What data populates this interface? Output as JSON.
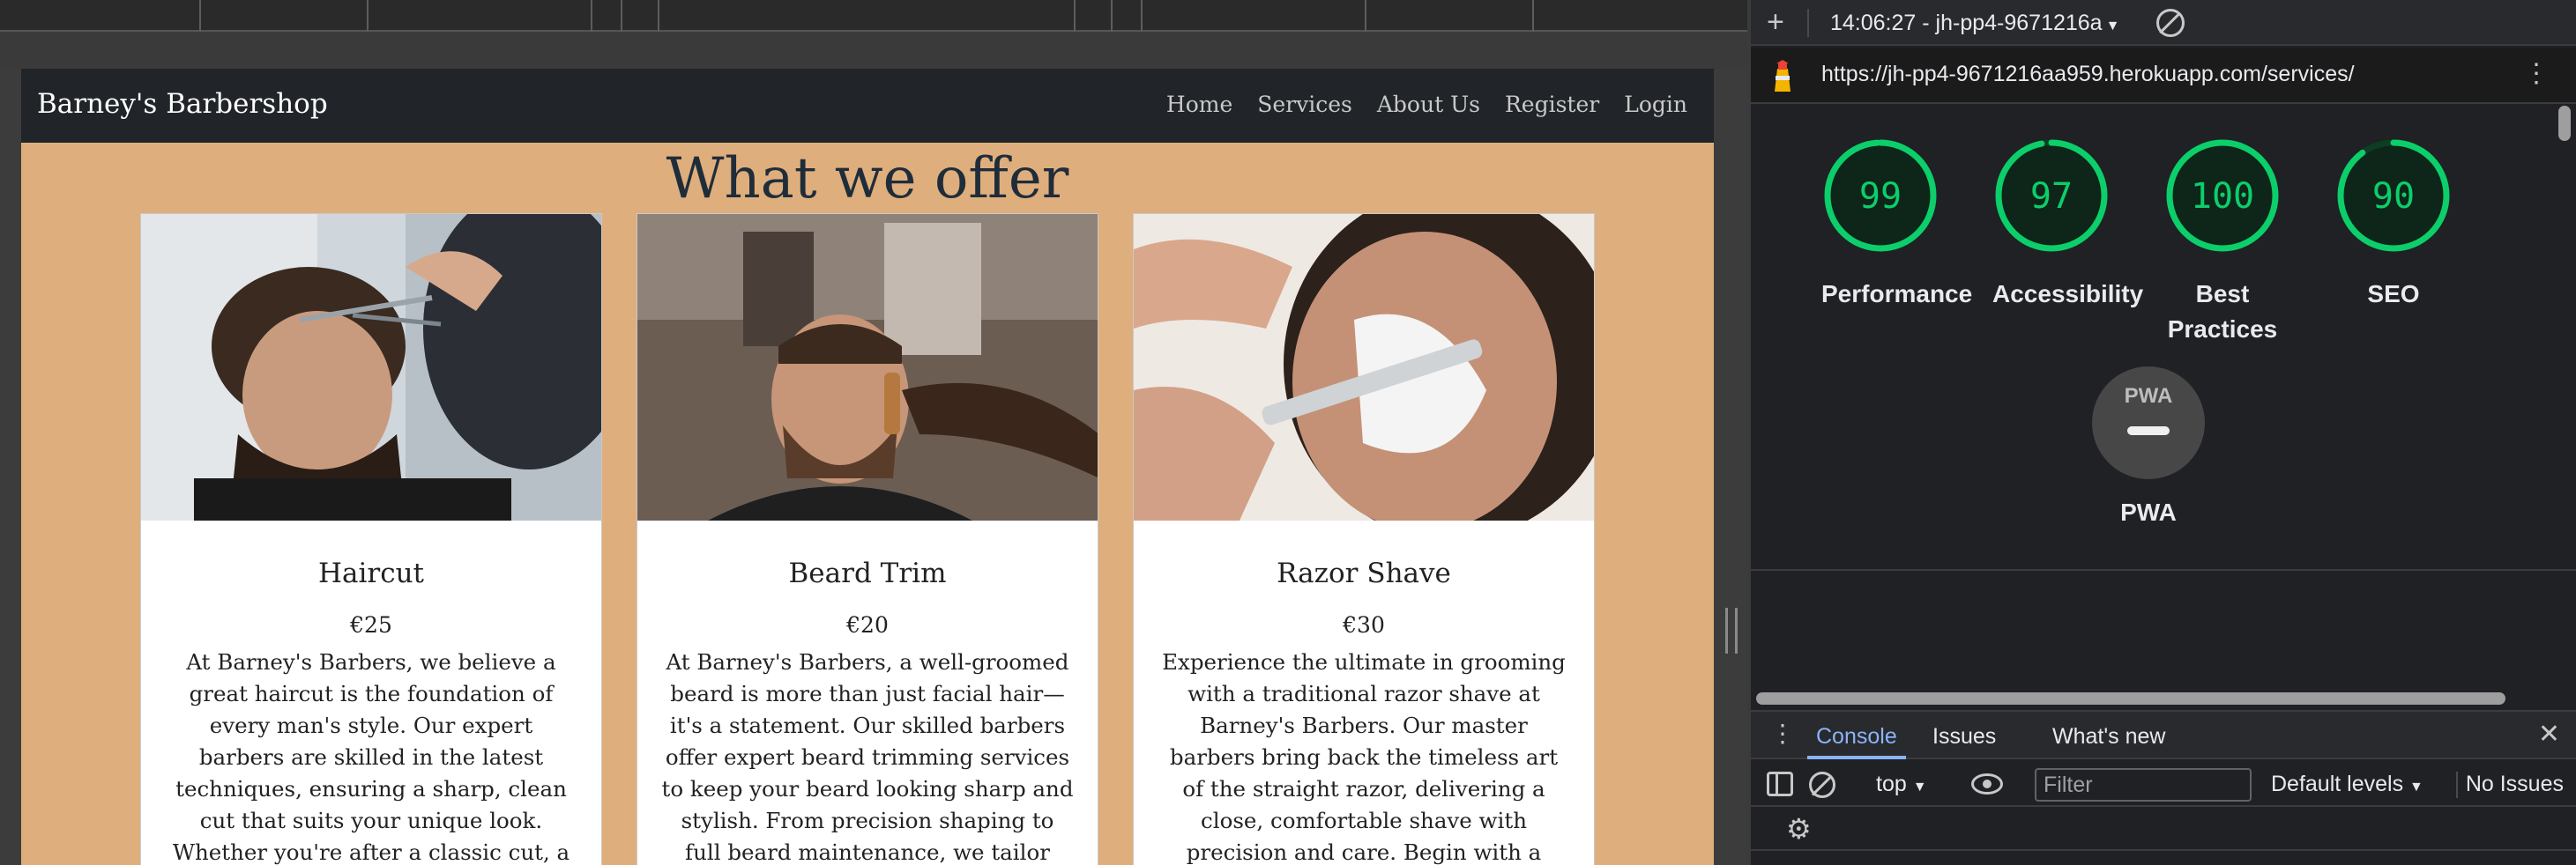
{
  "website": {
    "brand": "Barney's Barbershop",
    "nav": [
      "Home",
      "Services",
      "About Us",
      "Register",
      "Login"
    ],
    "heading": "What we offer",
    "cards": [
      {
        "title": "Haircut",
        "price": "€25",
        "description": "At Barney's Barbers, we believe a great haircut is the foundation of every man's style. Our expert barbers are skilled in the latest techniques, ensuring a sharp, clean cut that suits your unique look. Whether you're after a classic cut, a modern fade, or a tailored trim, our"
      },
      {
        "title": "Beard Trim",
        "price": "€20",
        "description": "At Barney's Barbers, a well-groomed beard is more than just facial hair—it's a statement. Our skilled barbers offer expert beard trimming services to keep your beard looking sharp and stylish. From precision shaping to full beard maintenance, we tailor each trim to"
      },
      {
        "title": "Razor Shave",
        "price": "€30",
        "description": "Experience the ultimate in grooming with a traditional razor shave at Barney's Barbers. Our master barbers bring back the timeless art of the straight razor, delivering a close, comfortable shave with precision and care. Begin with a relaxing hot towel"
      }
    ]
  },
  "devtools": {
    "report_label": "14:06:27 - jh-pp4-9671216a",
    "url": "https://jh-pp4-9671216aa959.herokuapp.com/services/",
    "scores": [
      {
        "label": "Performance",
        "value": 99
      },
      {
        "label": "Accessibility",
        "value": 97
      },
      {
        "label": "Best Practices",
        "value": 100
      },
      {
        "label": "SEO",
        "value": 90
      }
    ],
    "pwa": {
      "badge_text": "PWA",
      "label": "PWA"
    },
    "score_color": "#0cce6b",
    "drawer_tabs": [
      "Console",
      "Issues",
      "What's new"
    ],
    "console_bar": {
      "context": "top",
      "filter_placeholder": "Filter",
      "levels": "Default levels",
      "issues": "No Issues"
    }
  }
}
